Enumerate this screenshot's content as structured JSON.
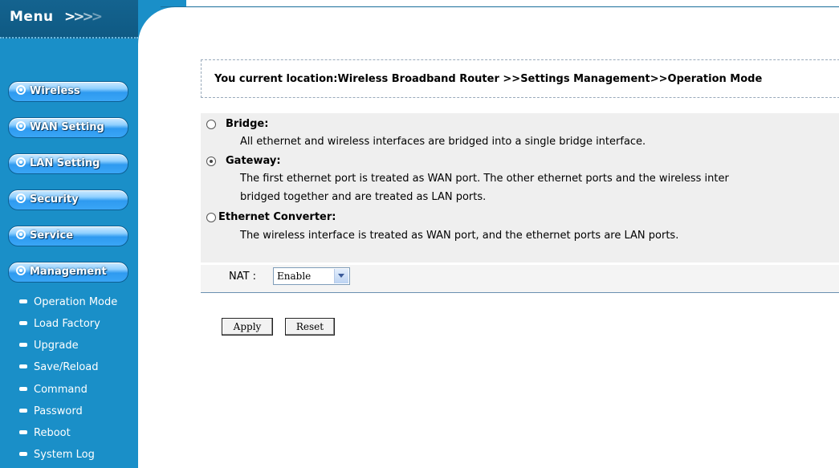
{
  "sidebar": {
    "title": "Menu",
    "title_arrows": [
      ">",
      ">",
      ">",
      ">"
    ],
    "nav": [
      {
        "label": "Wireless"
      },
      {
        "label": "WAN Setting"
      },
      {
        "label": "LAN Setting"
      },
      {
        "label": "Security"
      },
      {
        "label": "Service"
      },
      {
        "label": "Management"
      }
    ],
    "sub_items": [
      {
        "label": "Operation Mode"
      },
      {
        "label": "Load Factory"
      },
      {
        "label": "Upgrade"
      },
      {
        "label": "Save/Reload"
      },
      {
        "label": "Command"
      },
      {
        "label": "Password"
      },
      {
        "label": "Reboot"
      },
      {
        "label": "System Log"
      }
    ]
  },
  "breadcrumb": "You current location:Wireless Broadband Router >>Settings Management>>Operation Mode",
  "modes": [
    {
      "title": "Bridge:",
      "checked": false,
      "desc": [
        "All ethernet and wireless interfaces are bridged into a single bridge interface."
      ]
    },
    {
      "title": "Gateway:",
      "checked": true,
      "desc": [
        "The first ethernet port is treated as WAN port. The other ethernet ports and the wireless inter",
        "bridged together and are treated as LAN ports."
      ]
    },
    {
      "title": "Ethernet Converter:",
      "checked": false,
      "desc": [
        "The wireless interface is treated as WAN port, and the ethernet ports are LAN ports."
      ]
    }
  ],
  "nat": {
    "label": "NAT :",
    "value": "Enable"
  },
  "buttons": {
    "apply": "Apply",
    "reset": "Reset"
  },
  "colors": {
    "sidebar_bg": "#1a8fc8",
    "header_bg": "#14638f",
    "pill_border": "#0d5f93"
  }
}
